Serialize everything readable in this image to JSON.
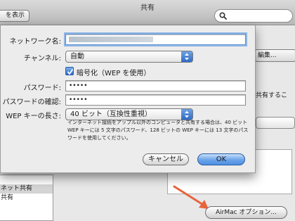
{
  "window": {
    "title": "共有",
    "show_all_label": "を表示",
    "search_placeholder": ""
  },
  "background": {
    "edit_button_label": "編集...",
    "right_text": "共有するこ",
    "service_items": [
      "",
      "ネット共有",
      "共有"
    ],
    "airmac_options_label": "AirMac オプション..."
  },
  "sheet": {
    "network_name_label": "ネットワーク名:",
    "network_name_value": "",
    "channel_label": "チャンネル:",
    "channel_value": "自動",
    "encrypt_checkbox_label": "暗号化（WEP を使用）",
    "encrypt_checked": true,
    "password_label": "パスワード:",
    "password_value": "•••••",
    "confirm_label": "パスワードの確認:",
    "confirm_value": "•••••",
    "wep_length_label": "WEP キーの長さ:",
    "wep_length_value": "40 ビット（互換性重視）",
    "note": "インターネット接続をアップル以外のコンピュータと共有する場合は、40 ビット WEP キーには 5 文字のパスワード、128 ビットの WEP キーには 13 文字のパスワードを使用してください。",
    "cancel_label": "キャンセル",
    "ok_label": "OK"
  },
  "colors": {
    "accent": "#4f8fe0",
    "arrow": "#e8643c"
  }
}
